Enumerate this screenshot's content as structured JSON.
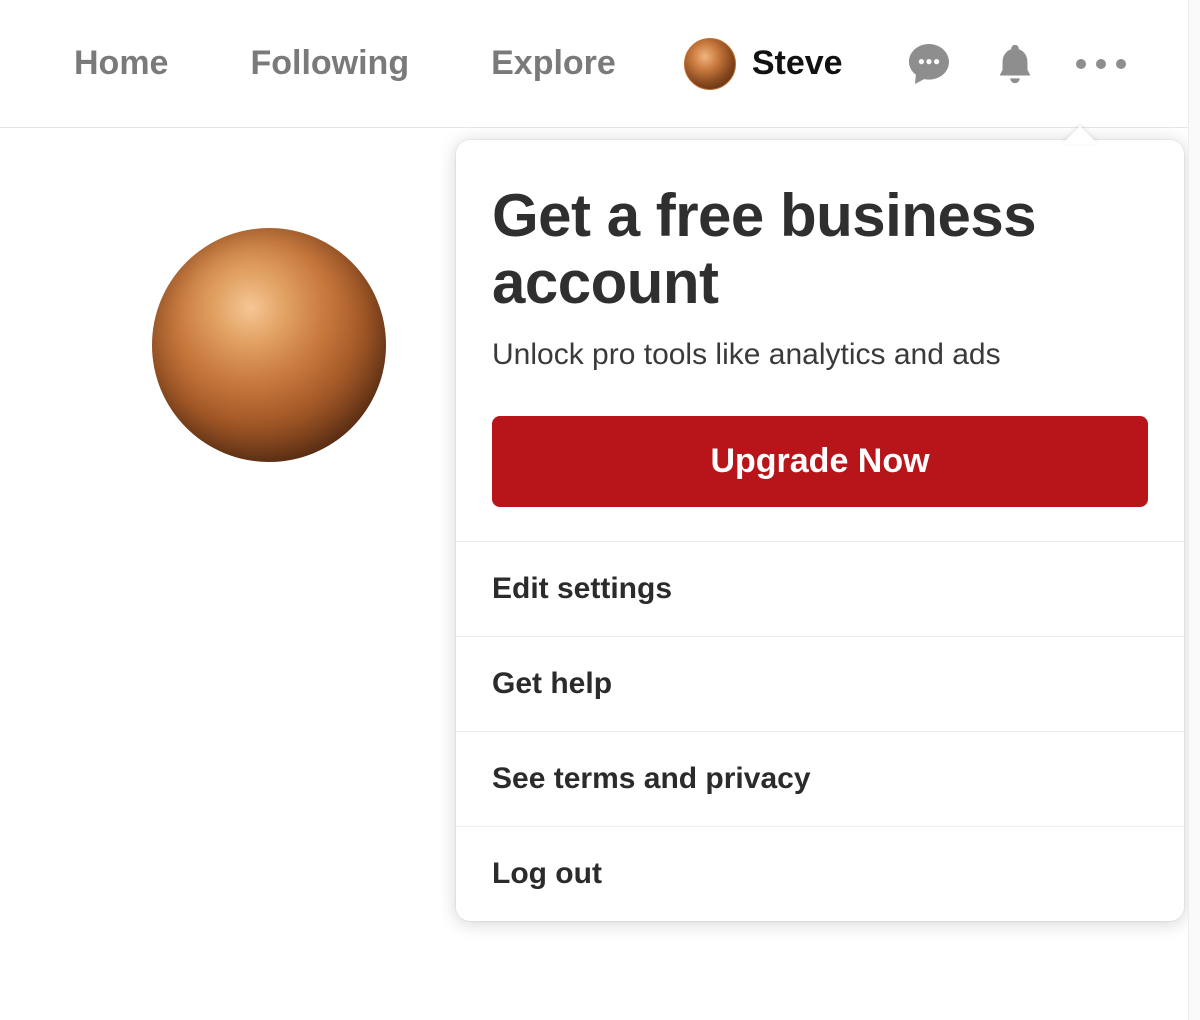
{
  "nav": {
    "home": "Home",
    "following": "Following",
    "explore": "Explore"
  },
  "profile": {
    "name": "Steve"
  },
  "menu": {
    "promo": {
      "title": "Get a free business account",
      "subtitle": "Unlock pro tools like analytics and ads",
      "cta": "Upgrade Now"
    },
    "items": [
      "Edit settings",
      "Get help",
      "See terms and privacy",
      "Log out"
    ]
  }
}
